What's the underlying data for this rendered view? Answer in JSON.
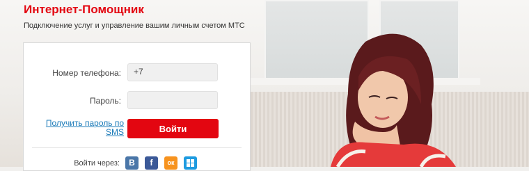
{
  "header": {
    "title": "Интернет-Помощник",
    "subtitle": "Подключение услуг и управление вашим личным счетом МТС"
  },
  "login": {
    "phone_label": "Номер телефона:",
    "phone_prefix": "+7",
    "phone_value": "",
    "password_label": "Пароль:",
    "password_value": "",
    "sms_link": "Получить пароль по SMS",
    "submit_label": "Войти",
    "via_label": "Войти через:"
  },
  "social": [
    {
      "icon": "vkontakte-icon",
      "glyph": "B",
      "color": "#4a76a8"
    },
    {
      "icon": "facebook-icon",
      "glyph": "f",
      "color": "#3b5998"
    },
    {
      "icon": "odnoklassniki-icon",
      "glyph": "ок",
      "color": "#f7931e"
    },
    {
      "icon": "windows-icon",
      "glyph": "",
      "color": "#1e9be0"
    }
  ],
  "colors": {
    "brand": "#e30611",
    "link": "#1a7ab8"
  }
}
